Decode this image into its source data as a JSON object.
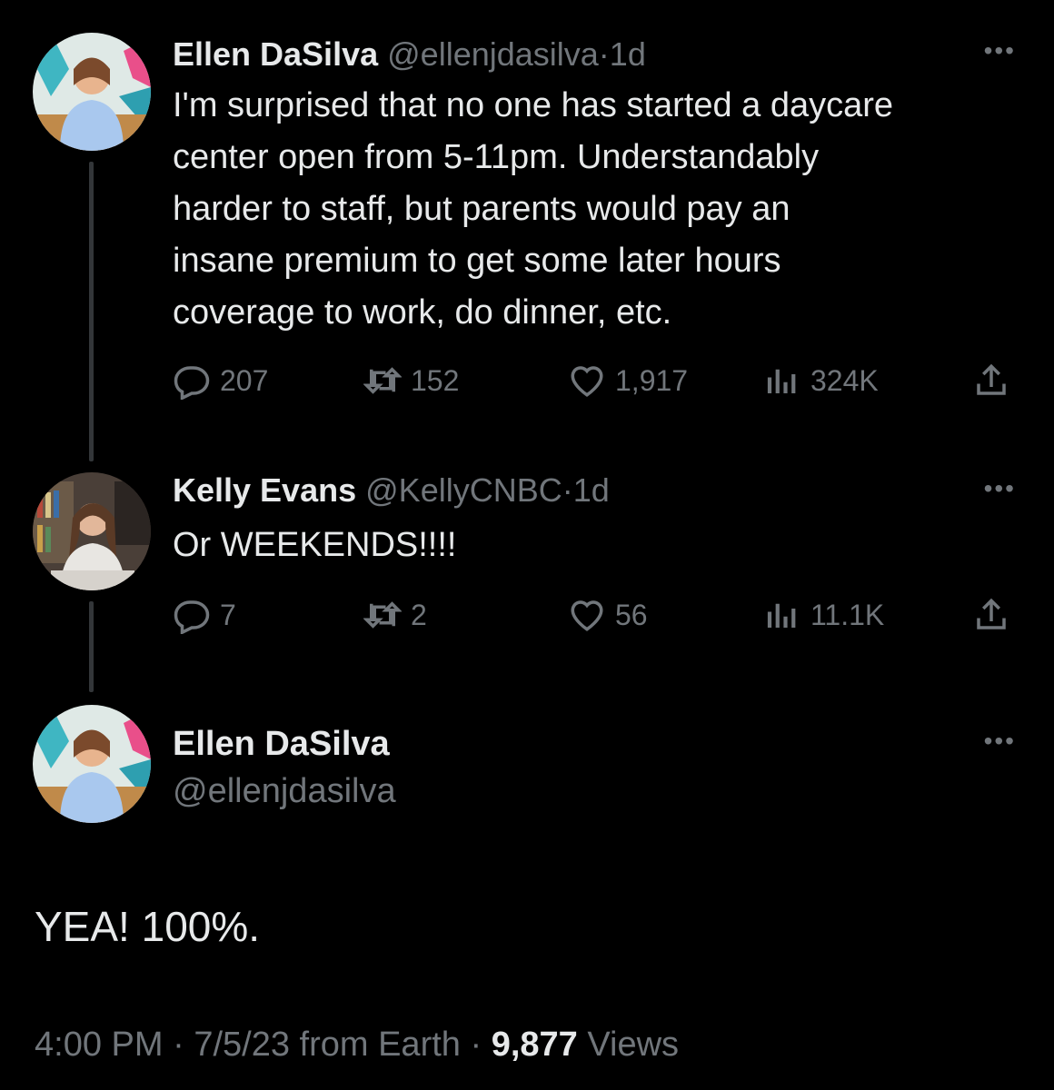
{
  "tweets": [
    {
      "name": "Ellen DaSilva",
      "handle": "@ellenjdasilva",
      "separator": "·",
      "time": "1d",
      "text": "I'm surprised that no one has started a daycare\ncenter open from 5-11pm. Understandably\nharder to staff, but parents would pay an\ninsane premium to get some later hours\ncoverage to work, do dinner, etc.",
      "stats": {
        "replies": "207",
        "retweets": "152",
        "likes": "1,917",
        "views": "324K"
      }
    },
    {
      "name": "Kelly Evans",
      "handle": "@KellyCNBC",
      "separator": "·",
      "time": "1d",
      "text": "Or WEEKENDS!!!!",
      "stats": {
        "replies": "7",
        "retweets": "2",
        "likes": "56",
        "views": "11.1K"
      }
    }
  ],
  "main_tweet": {
    "name": "Ellen DaSilva",
    "handle": "@ellenjdasilva",
    "text": "YEA! 100%.",
    "meta": {
      "time": "4:00 PM",
      "sep1": "·",
      "date": "7/5/23",
      "source": "from Earth",
      "sep2": "·",
      "views_count": "9,877",
      "views_label": "Views"
    }
  },
  "more_label": "•••",
  "icons": {
    "reply": "reply-icon",
    "retweet": "retweet-icon",
    "like": "heart-icon",
    "views": "views-bar-icon",
    "share": "share-icon",
    "more": "more-icon"
  }
}
